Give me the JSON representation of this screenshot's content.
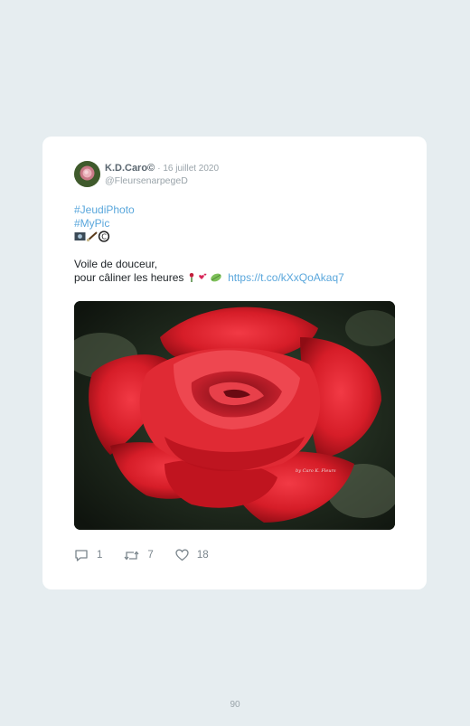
{
  "tweet": {
    "author_name": "K.D.Caro©",
    "date": "· 16 juillet 2020",
    "handle": "@FleursenarpegeD",
    "hashtag1": "#JeudiPhoto",
    "hashtag2": "#MyPic",
    "line1": "Voile de douceur,",
    "line2": "pour câliner les heures",
    "link": "https://t.co/kXxQoAkaq7",
    "image_alt": "red rose photo",
    "watermark": "by Caro K. Fleurs"
  },
  "actions": {
    "replies": "1",
    "retweets": "7",
    "likes": "18"
  },
  "page_number": "90",
  "colors": {
    "background": "#e6edf0",
    "link": "#5aa7dc",
    "muted": "#9aa4aa"
  }
}
